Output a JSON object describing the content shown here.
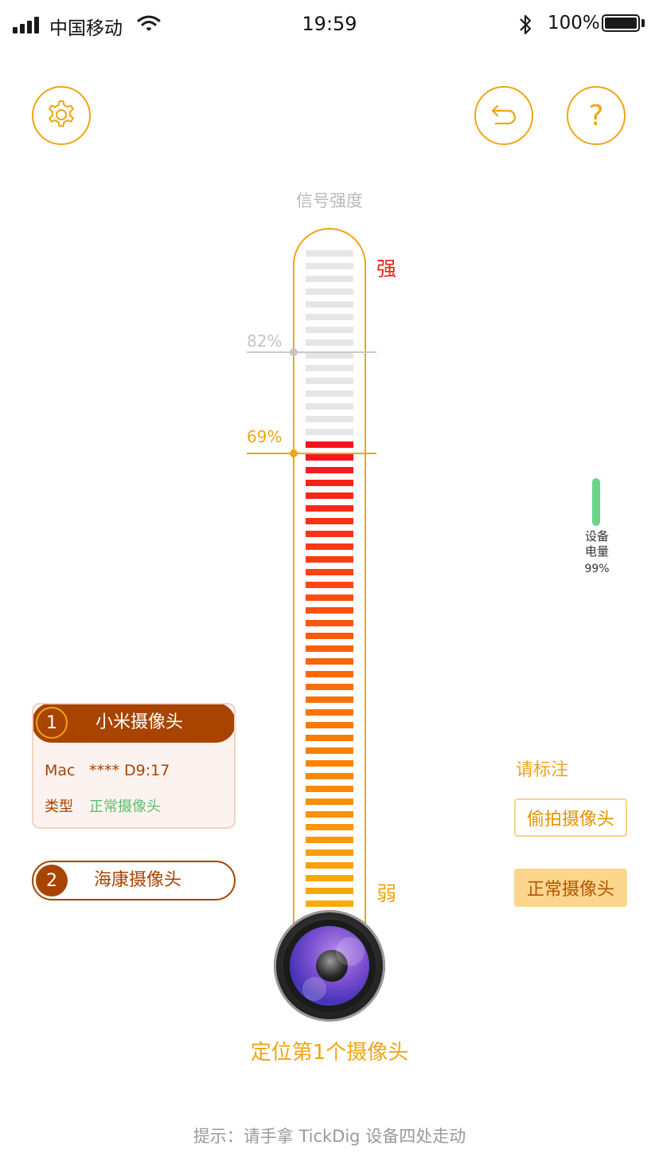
{
  "status_bar": {
    "carrier": "中国移动",
    "time": "19:59",
    "battery_percent": "100%"
  },
  "toolbar": {
    "settings_icon": "gear-icon",
    "back_icon": "undo-arrow-icon",
    "help_icon": "question-mark-icon",
    "help_glyph": "?"
  },
  "signal": {
    "title": "信号强度",
    "strong_label": "强",
    "weak_label": "弱",
    "max_marker": "82%",
    "current_marker": "69%",
    "level_percent": 69
  },
  "device_battery": {
    "label_line1": "设备",
    "label_line2": "电量",
    "percent": "99%"
  },
  "cameras": [
    {
      "index": "1",
      "name": "小米摄像头",
      "mac_label": "Mac",
      "mac_value": "**** D9:17",
      "type_label": "类型",
      "type_value": "正常摄像头"
    },
    {
      "index": "2",
      "name": "海康摄像头"
    }
  ],
  "marking": {
    "title": "请标注",
    "spy_button": "偷拍摄像头",
    "normal_button": "正常摄像头"
  },
  "locate_text": "定位第1个摄像头",
  "tip_text": "提示：请手拿 TickDig 设备四处走动",
  "colors": {
    "accent": "#f0a514",
    "brown": "#a84300",
    "strong_red": "#e8231c",
    "green": "#5bbf6a",
    "inactive_segment": "#e6e6e6"
  }
}
